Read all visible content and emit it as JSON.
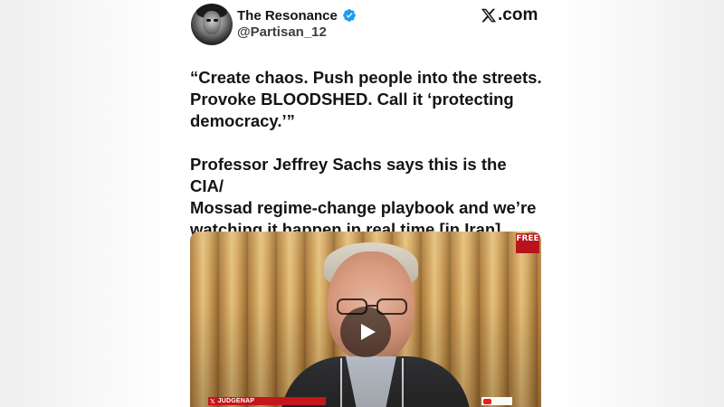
{
  "author": {
    "display_name": "The Resonance",
    "handle": "@Partisan_12",
    "verified": true,
    "avatar_icon": "avatar-photo"
  },
  "site_badge": {
    "label": ".com",
    "icon": "x-logo-icon"
  },
  "tweet": {
    "paragraphs": [
      "“Create chaos. Push people into the streets.\nProvoke BLOODSHED. Call it ‘protecting\ndemocracy.’”",
      "Professor Jeffrey Sachs says this is the CIA/\nMossad regime-change playbook and we’re\nwatching it happen in real time [in Iran]."
    ]
  },
  "video": {
    "badge_label": "FREE",
    "chyron_left": "JUDGENAP",
    "play_icon": "play-icon"
  },
  "colors": {
    "verified_blue": "#1d9bf0",
    "text": "#0f1419",
    "chyron_red": "#c4161c"
  }
}
